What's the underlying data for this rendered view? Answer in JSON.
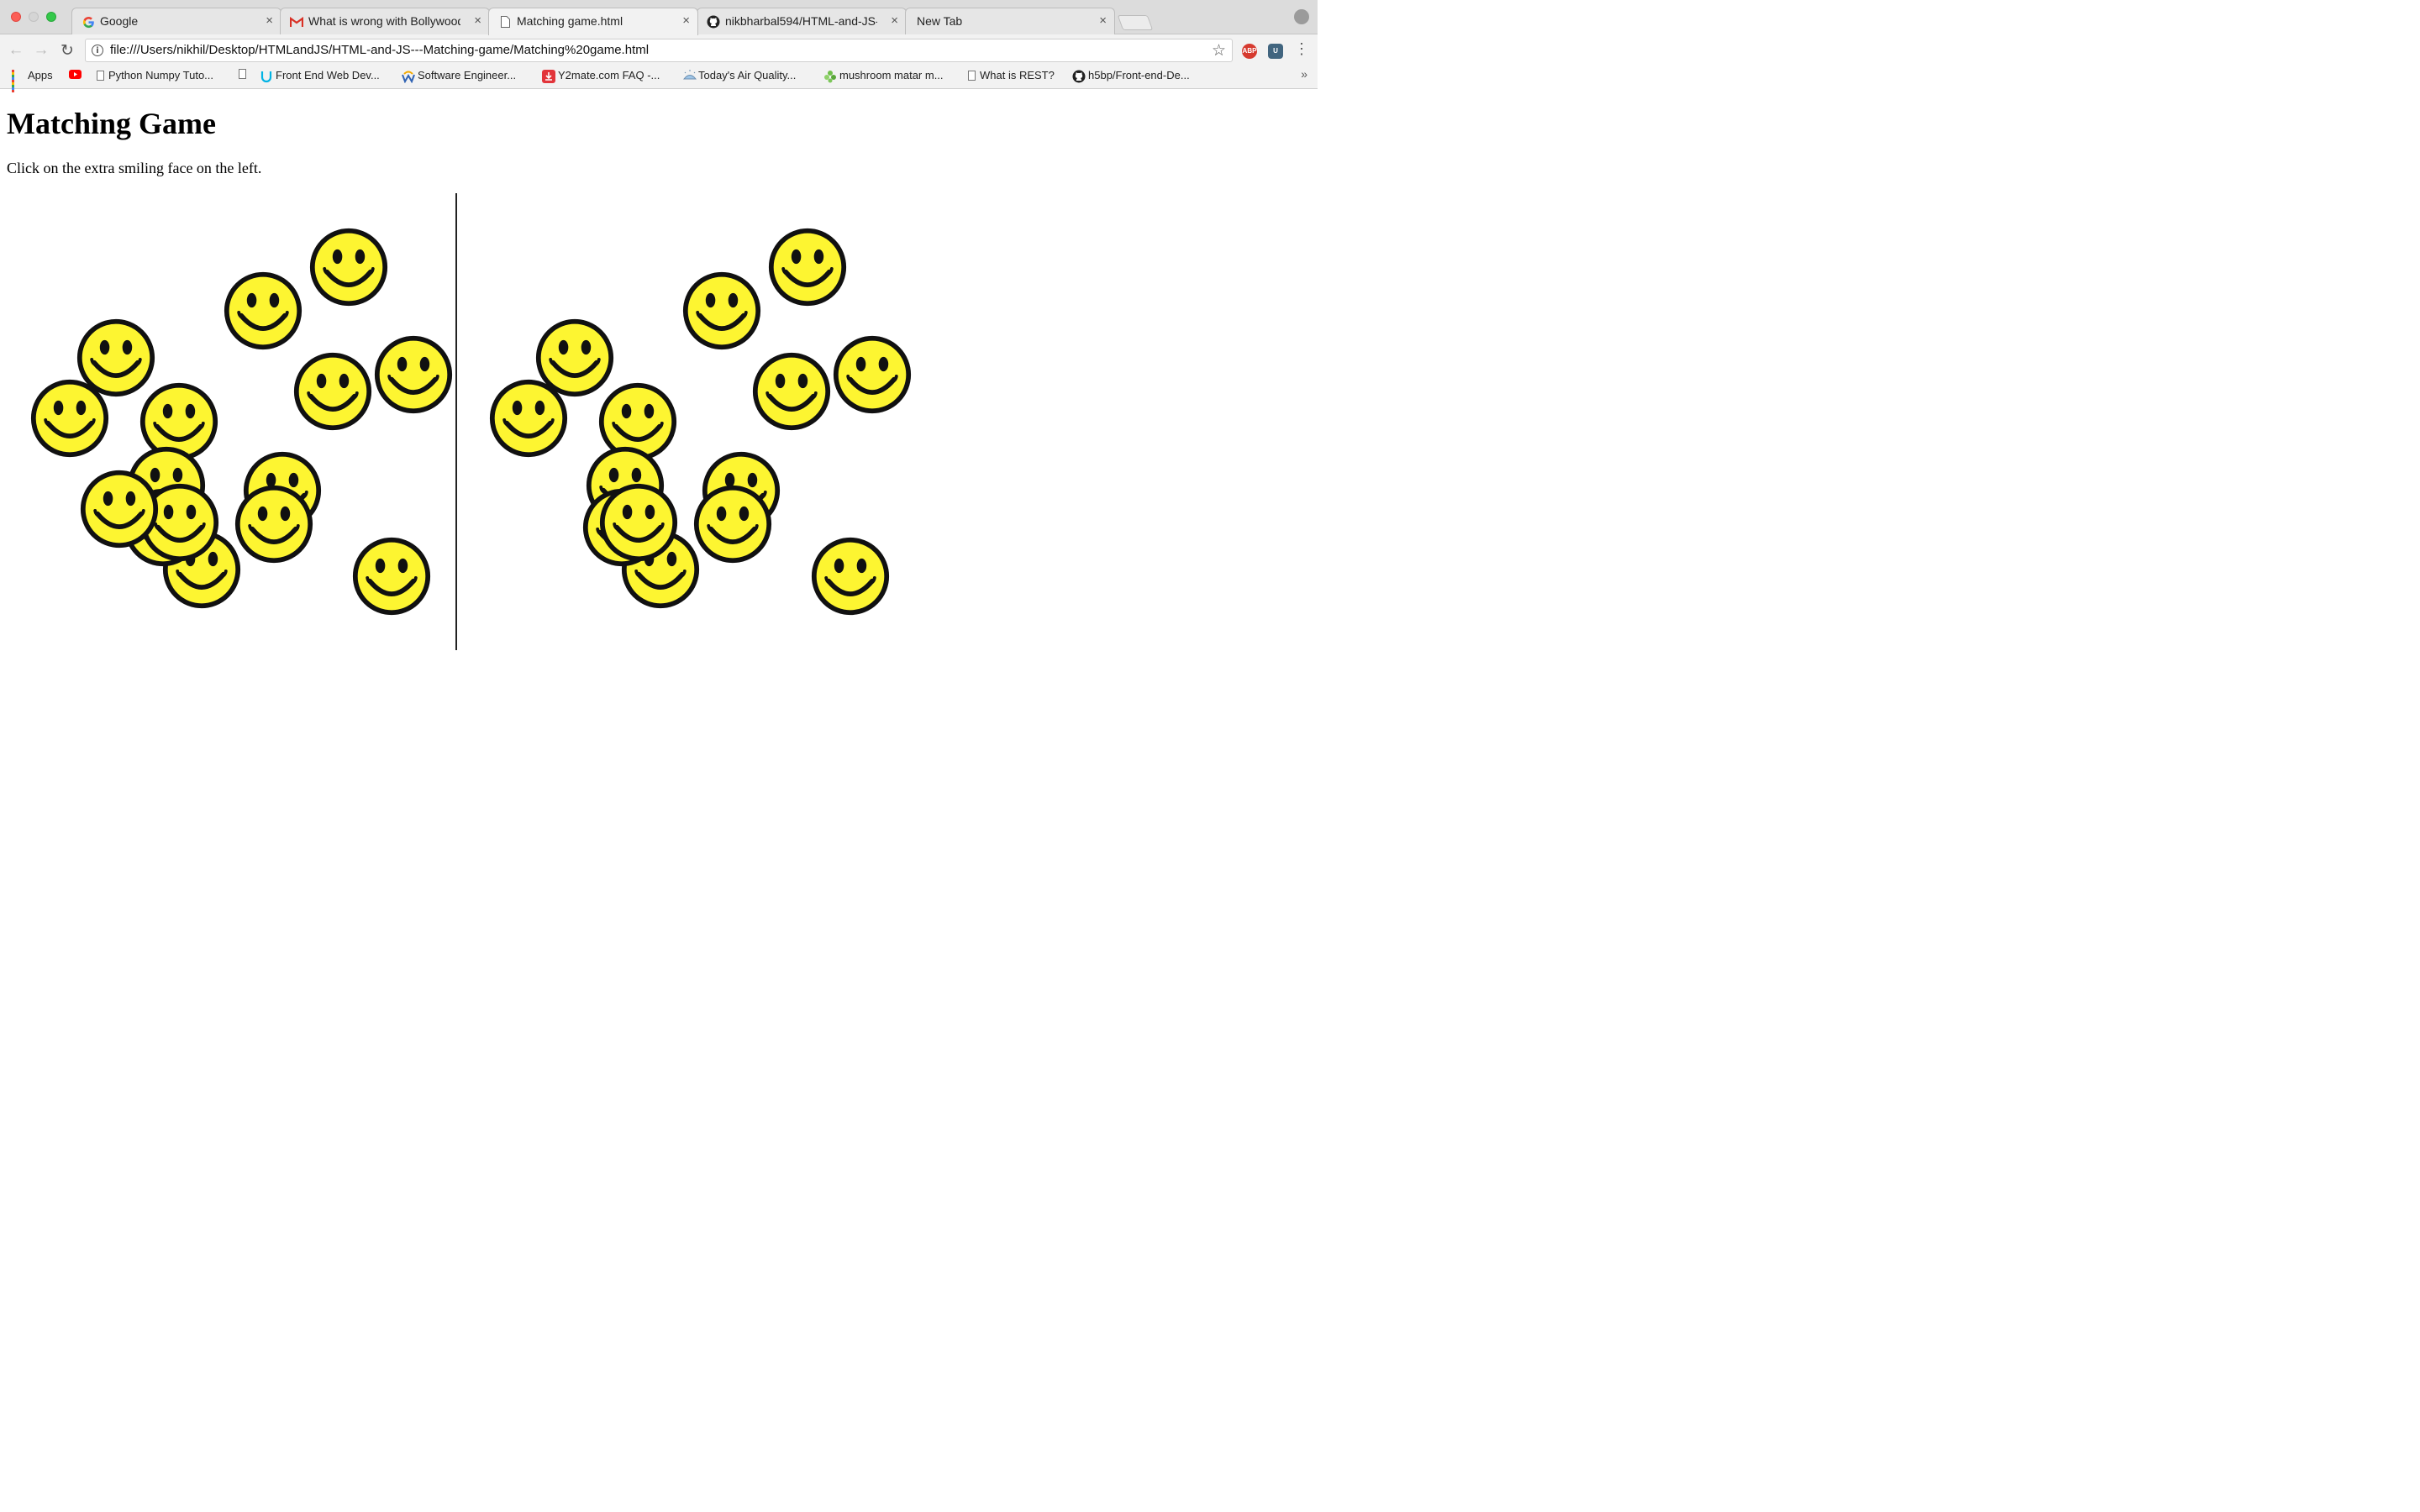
{
  "browser": {
    "tabs": [
      {
        "title": "Google",
        "favicon": "google-g-icon",
        "active": false
      },
      {
        "title": "What is wrong with Bollywood?",
        "favicon": "gmail-m-icon",
        "active": false
      },
      {
        "title": "Matching game.html",
        "favicon": "document-icon",
        "active": true
      },
      {
        "title": "nikbharbal594/HTML-and-JS-",
        "favicon": "github-icon",
        "active": false
      },
      {
        "title": "New Tab",
        "favicon": "",
        "active": false
      }
    ],
    "close_glyph": "×",
    "address": "file:///Users/nikhil/Desktop/HTMLandJS/HTML-and-JS---Matching-game/Matching%20game.html",
    "info_glyph": "i",
    "extensions": {
      "abp": "ABP",
      "udacity": "U"
    },
    "bookmarks": [
      {
        "label": "Apps",
        "icon": "apps-grid-icon"
      },
      {
        "label": "",
        "icon": "youtube-icon"
      },
      {
        "label": "Python Numpy Tuto...",
        "icon": "document-icon"
      },
      {
        "label": "",
        "icon": "document-icon"
      },
      {
        "label": "Front End Web Dev...",
        "icon": "udacity-icon"
      },
      {
        "label": "Software Engineer...",
        "icon": "w-icon"
      },
      {
        "label": "Y2mate.com FAQ -...",
        "icon": "download-icon"
      },
      {
        "label": "Today's Air Quality...",
        "icon": "air-quality-icon"
      },
      {
        "label": "mushroom matar m...",
        "icon": "leaf-icon"
      },
      {
        "label": "What is REST?",
        "icon": "document-icon"
      },
      {
        "label": "h5bp/Front-end-De...",
        "icon": "github-icon"
      }
    ],
    "overflow_glyph": "»"
  },
  "page": {
    "title": "Matching Game",
    "instructions": "Click on the extra smiling face on the left."
  },
  "colors": {
    "smiley_face": "#fdf531",
    "smiley_outline": "#111111",
    "divider": "#222222"
  }
}
